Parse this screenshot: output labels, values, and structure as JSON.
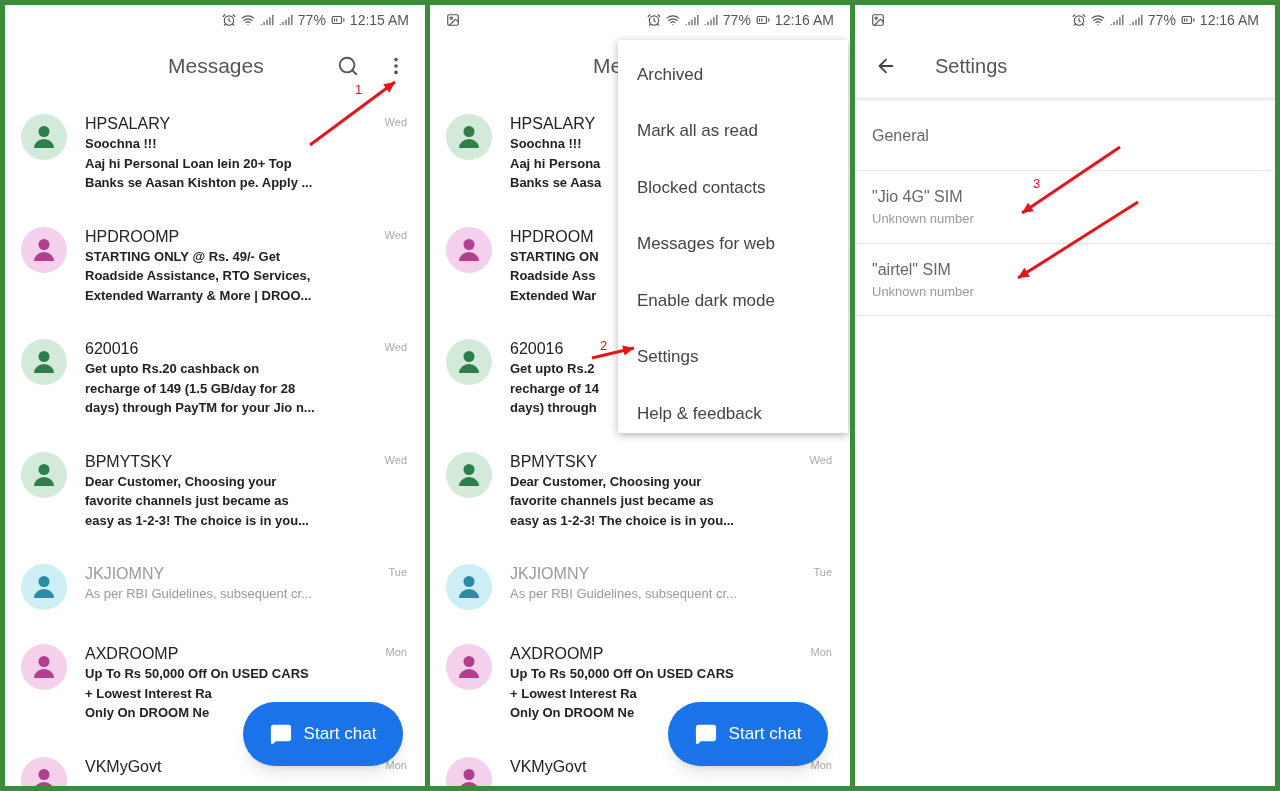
{
  "panels": [
    {
      "kind": "list",
      "status_bar": {
        "battery": "77%",
        "time": "12:15 AM"
      },
      "title": "Messages",
      "actions": [
        {
          "kind": "search"
        },
        {
          "kind": "more"
        }
      ],
      "conversations": [
        {
          "name": "HPSALARY",
          "time": "Wed",
          "unread": true,
          "color": "#2e7d4a",
          "lines": [
            "Soochna !!!",
            "Aaj hi Personal Loan lein 20+ Top",
            "Banks se Aasan Kishton pe. Apply ..."
          ]
        },
        {
          "name": "HPDROOMP",
          "time": "Wed",
          "unread": true,
          "color": "#b0408e",
          "lines": [
            "STARTING ONLY @ Rs. 49/- Get",
            "Roadside Assistance, RTO Services,",
            "Extended Warranty & More | DROO..."
          ]
        },
        {
          "name": "620016",
          "time": "Wed",
          "unread": true,
          "color": "#2e7d4a",
          "lines": [
            "Get upto Rs.20 cashback on",
            "recharge of 149 (1.5 GB/day for 28",
            "days) through PayTM for your Jio n..."
          ]
        },
        {
          "name": "BPMYTSKY",
          "time": "Wed",
          "unread": true,
          "color": "#2e7d4a",
          "lines": [
            "Dear Customer, Choosing your",
            "favorite channels just became as",
            "easy as 1-2-3! The choice is in you..."
          ]
        },
        {
          "name": "JKJIOMNY",
          "time": "Tue",
          "unread": false,
          "color": "#2d8aa0",
          "lines": [
            "As per RBI Guidelines, subsequent cr..."
          ]
        },
        {
          "name": "AXDROOMP",
          "time": "Mon",
          "unread": true,
          "color": "#b0408e",
          "lines": [
            "Up To Rs 50,000 Off On USED CARS",
            "+ Lowest Interest Ra",
            "Only On DROOM Ne"
          ]
        },
        {
          "name": "VKMyGovt",
          "time": "Mon",
          "unread": true,
          "color": "#b0408e"
        }
      ],
      "fab": {
        "label": "Start chat"
      }
    },
    {
      "kind": "list",
      "status_bar": {
        "has_notification": true,
        "battery": "77%",
        "time": "12:16 AM"
      },
      "title": "Me",
      "conversations": [
        {
          "name": "HPSALARY",
          "unread": true,
          "color": "#2e7d4a",
          "lines": [
            "Soochna !!!",
            "Aaj hi Persona",
            "Banks se Aasa"
          ]
        },
        {
          "name": "HPDROOM",
          "unread": true,
          "color": "#b0408e",
          "lines": [
            "STARTING ON",
            "Roadside Ass",
            "Extended War"
          ]
        },
        {
          "name": "620016",
          "unread": true,
          "color": "#2e7d4a",
          "lines": [
            "Get upto Rs.2",
            "recharge of 14",
            "days) through"
          ]
        },
        {
          "name": "BPMYTSKY",
          "time": "Wed",
          "unread": true,
          "color": "#2e7d4a",
          "lines": [
            "Dear Customer, Choosing your",
            "favorite channels just became as",
            "easy as 1-2-3! The choice is in you..."
          ]
        },
        {
          "name": "JKJIOMNY",
          "time": "Tue",
          "unread": false,
          "color": "#2d8aa0",
          "lines": [
            "As per RBI Guidelines, subsequent cr..."
          ]
        },
        {
          "name": "AXDROOMP",
          "time": "Mon",
          "unread": true,
          "color": "#b0408e",
          "lines": [
            "Up To Rs 50,000 Off On USED CARS",
            "+ Lowest Interest Ra",
            "Only On DROOM Ne"
          ]
        },
        {
          "name": "VKMyGovt",
          "time": "Mon",
          "unread": true,
          "color": "#b0408e"
        }
      ],
      "fab": {
        "label": "Start chat"
      },
      "menu": [
        "Archived",
        "Mark all as read",
        "Blocked contacts",
        "Messages for web",
        "Enable dark mode",
        "Settings",
        "Help & feedback"
      ]
    },
    {
      "kind": "settings",
      "status_bar": {
        "has_notification": true,
        "battery": "77%",
        "time": "12:16 AM"
      },
      "title": "Settings",
      "items": [
        {
          "title": "General"
        },
        {
          "title": "\"Jio 4G\" SIM",
          "subtitle": "Unknown number"
        },
        {
          "title": "\"airtel\" SIM",
          "subtitle": "Unknown number"
        }
      ]
    }
  ],
  "annotations": [
    {
      "label": "1"
    },
    {
      "label": "2"
    },
    {
      "label": "3"
    }
  ]
}
